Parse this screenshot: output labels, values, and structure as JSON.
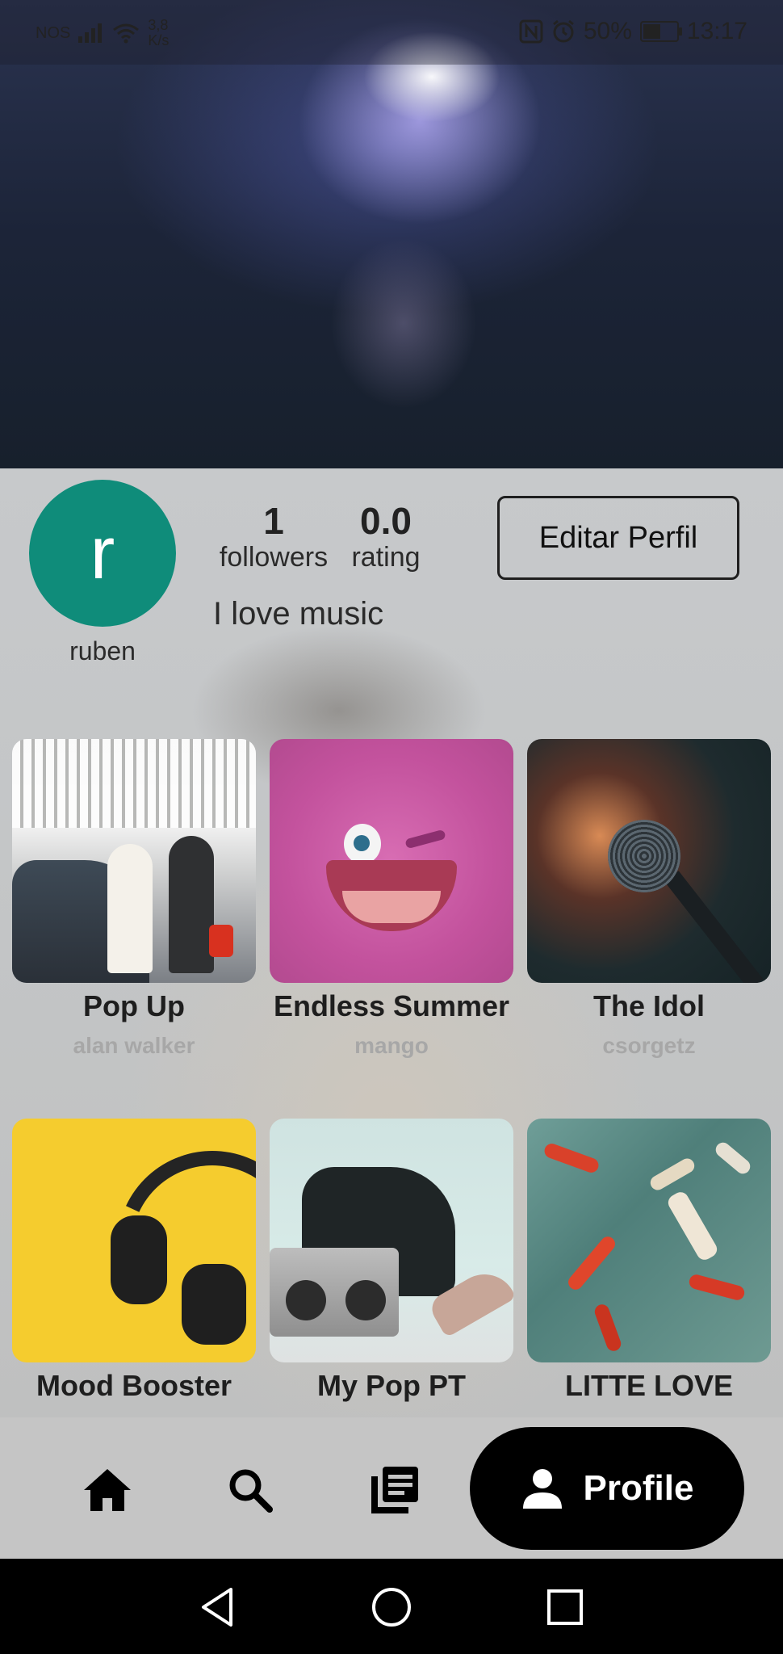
{
  "status_bar": {
    "carrier": "NOS",
    "net_speed_value": "3,8",
    "net_speed_unit": "K/s",
    "battery": "50%",
    "time": "13:17"
  },
  "profile": {
    "avatar_letter": "r",
    "username": "ruben",
    "followers_count": "1",
    "followers_label": "followers",
    "rating_value": "0.0",
    "rating_label": "rating",
    "bio": "I love music",
    "edit_button": "Editar Perfil"
  },
  "playlists": [
    {
      "title": "Pop Up",
      "artist": "alan walker"
    },
    {
      "title": "Endless Summer",
      "artist": "mango"
    },
    {
      "title": "The Idol",
      "artist": "csorgetz"
    },
    {
      "title": "Mood Booster",
      "artist": ""
    },
    {
      "title": "My Pop PT",
      "artist": ""
    },
    {
      "title": "LITTE LOVE",
      "artist": ""
    }
  ],
  "bottom_nav": {
    "items": [
      "home-icon",
      "search-icon",
      "library-icon",
      "profile-icon"
    ],
    "active_label": "Profile"
  },
  "colors": {
    "avatar": "#0f8c7a",
    "active_tab": "#000000"
  }
}
